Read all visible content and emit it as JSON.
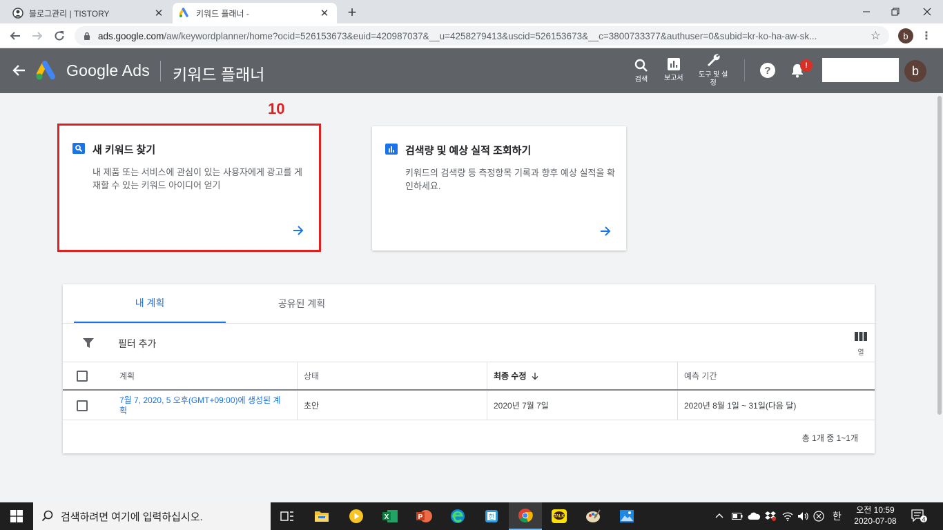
{
  "browser": {
    "tabs": [
      {
        "title": "블로그관리 | TISTORY",
        "icon": "profile-icon",
        "close": "✕"
      },
      {
        "title": "키워드 플래너 -",
        "icon": "google-ads-icon",
        "close": "✕"
      }
    ],
    "new_tab": "+",
    "url_host": "ads.google.com",
    "url_path": "/aw/keywordplanner/home?ocid=526153673&euid=420987037&__u=4258279413&uscid=526153673&__c=3800733377&authuser=0&subid=kr-ko-ha-aw-sk...",
    "profile_initial": "b"
  },
  "ads_header": {
    "brand": "Google Ads",
    "page_title": "키워드 플래너",
    "tools": [
      {
        "label": "검색",
        "icon": "search-icon"
      },
      {
        "label": "보고서",
        "icon": "reports-icon"
      },
      {
        "label_line1": "도구 및 설",
        "label_line2": "정",
        "icon": "wrench-icon"
      }
    ],
    "notification_badge": "!",
    "avatar_initial": "b",
    "colors": {
      "header_bg": "#5f6368",
      "accent": "#1a73e8",
      "annotation": "#e02020"
    }
  },
  "annotation": "10",
  "cards": [
    {
      "title": "새 키워드 찾기",
      "icon": "search-icon",
      "description": "내 제품 또는 서비스에 관심이 있는 사용자에게 광고를 게재할 수 있는 키워드 아이디어 얻기"
    },
    {
      "title": "검색량 및 예상 실적 조회하기",
      "icon": "bar-chart-icon",
      "description": "키워드의 검색량 등 측정항목 기록과 향후 예상 실적을 확인하세요."
    }
  ],
  "plans": {
    "tabs": [
      "내 계획",
      "공유된 계획"
    ],
    "filter_label": "필터 추가",
    "columns_label": "열",
    "headers": [
      "계획",
      "상태",
      "최종 수정",
      "예측 기간"
    ],
    "rows": [
      {
        "plan": "7월 7, 2020, 5 오후(GMT+09:00)에 생성된 계획",
        "status": "초안",
        "last_modified": "2020년 7월 7일",
        "forecast": "2020년 8월 1일 ~ 31일(다음 달)"
      }
    ],
    "pagination": "총 1개 중 1~1개"
  },
  "taskbar": {
    "search_placeholder": "검색하려면 여기에 입력하십시오.",
    "ime": "한",
    "time": "오전 10:59",
    "date": "2020-07-08",
    "notification_count": "4"
  }
}
